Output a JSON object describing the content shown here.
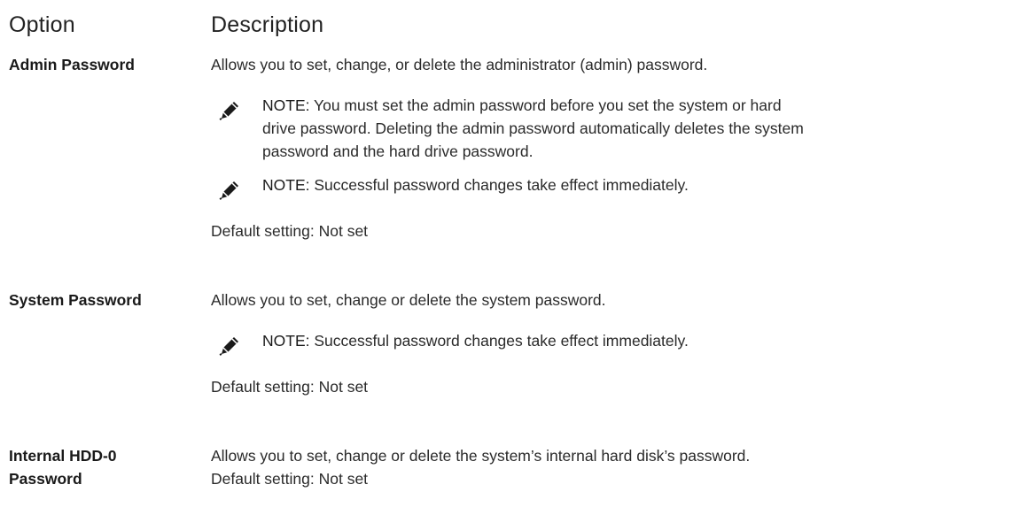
{
  "header": {
    "option": "Option",
    "description": "Description"
  },
  "rows": [
    {
      "option": "Admin Password",
      "description": "Allows you to set, change, or delete the administrator (admin) password.",
      "notes": [
        {
          "label": "NOTE:",
          "lines": [
            "You must set the admin password before you set the system or hard",
            "drive password. Deleting the admin password automatically deletes the system",
            "password and the hard drive password."
          ]
        },
        {
          "label": "NOTE:",
          "lines": [
            "Successful password changes take effect immediately."
          ]
        }
      ],
      "default": "Default setting: Not set"
    },
    {
      "option": "System Password",
      "description": "Allows you to set, change or delete the system password.",
      "notes": [
        {
          "label": "NOTE:",
          "lines": [
            "Successful password changes take effect immediately."
          ]
        }
      ],
      "default": "Default setting: Not set"
    },
    {
      "option_lines": [
        "Internal HDD-0",
        "Password"
      ],
      "description": "Allows you to set, change or delete the system’s internal hard disk’s password.",
      "default": "Default setting: Not set"
    }
  ],
  "icons": {
    "note": "pencil-note-icon"
  }
}
